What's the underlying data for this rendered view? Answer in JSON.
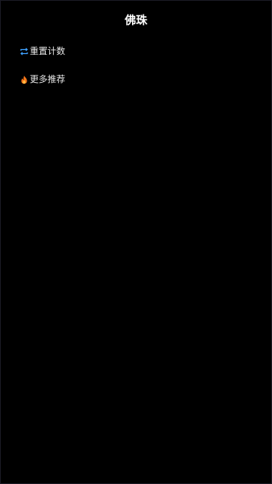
{
  "header": {
    "title": "佛珠"
  },
  "menu": {
    "items": [
      {
        "label": "重置计数",
        "icon": "repeat-icon"
      },
      {
        "label": "更多推荐",
        "icon": "fire-icon"
      }
    ]
  },
  "colors": {
    "background": "#000000",
    "text": "#ffffff",
    "repeat_icon": "#3ea0ff",
    "fire_icon": "#ff7a1a"
  }
}
